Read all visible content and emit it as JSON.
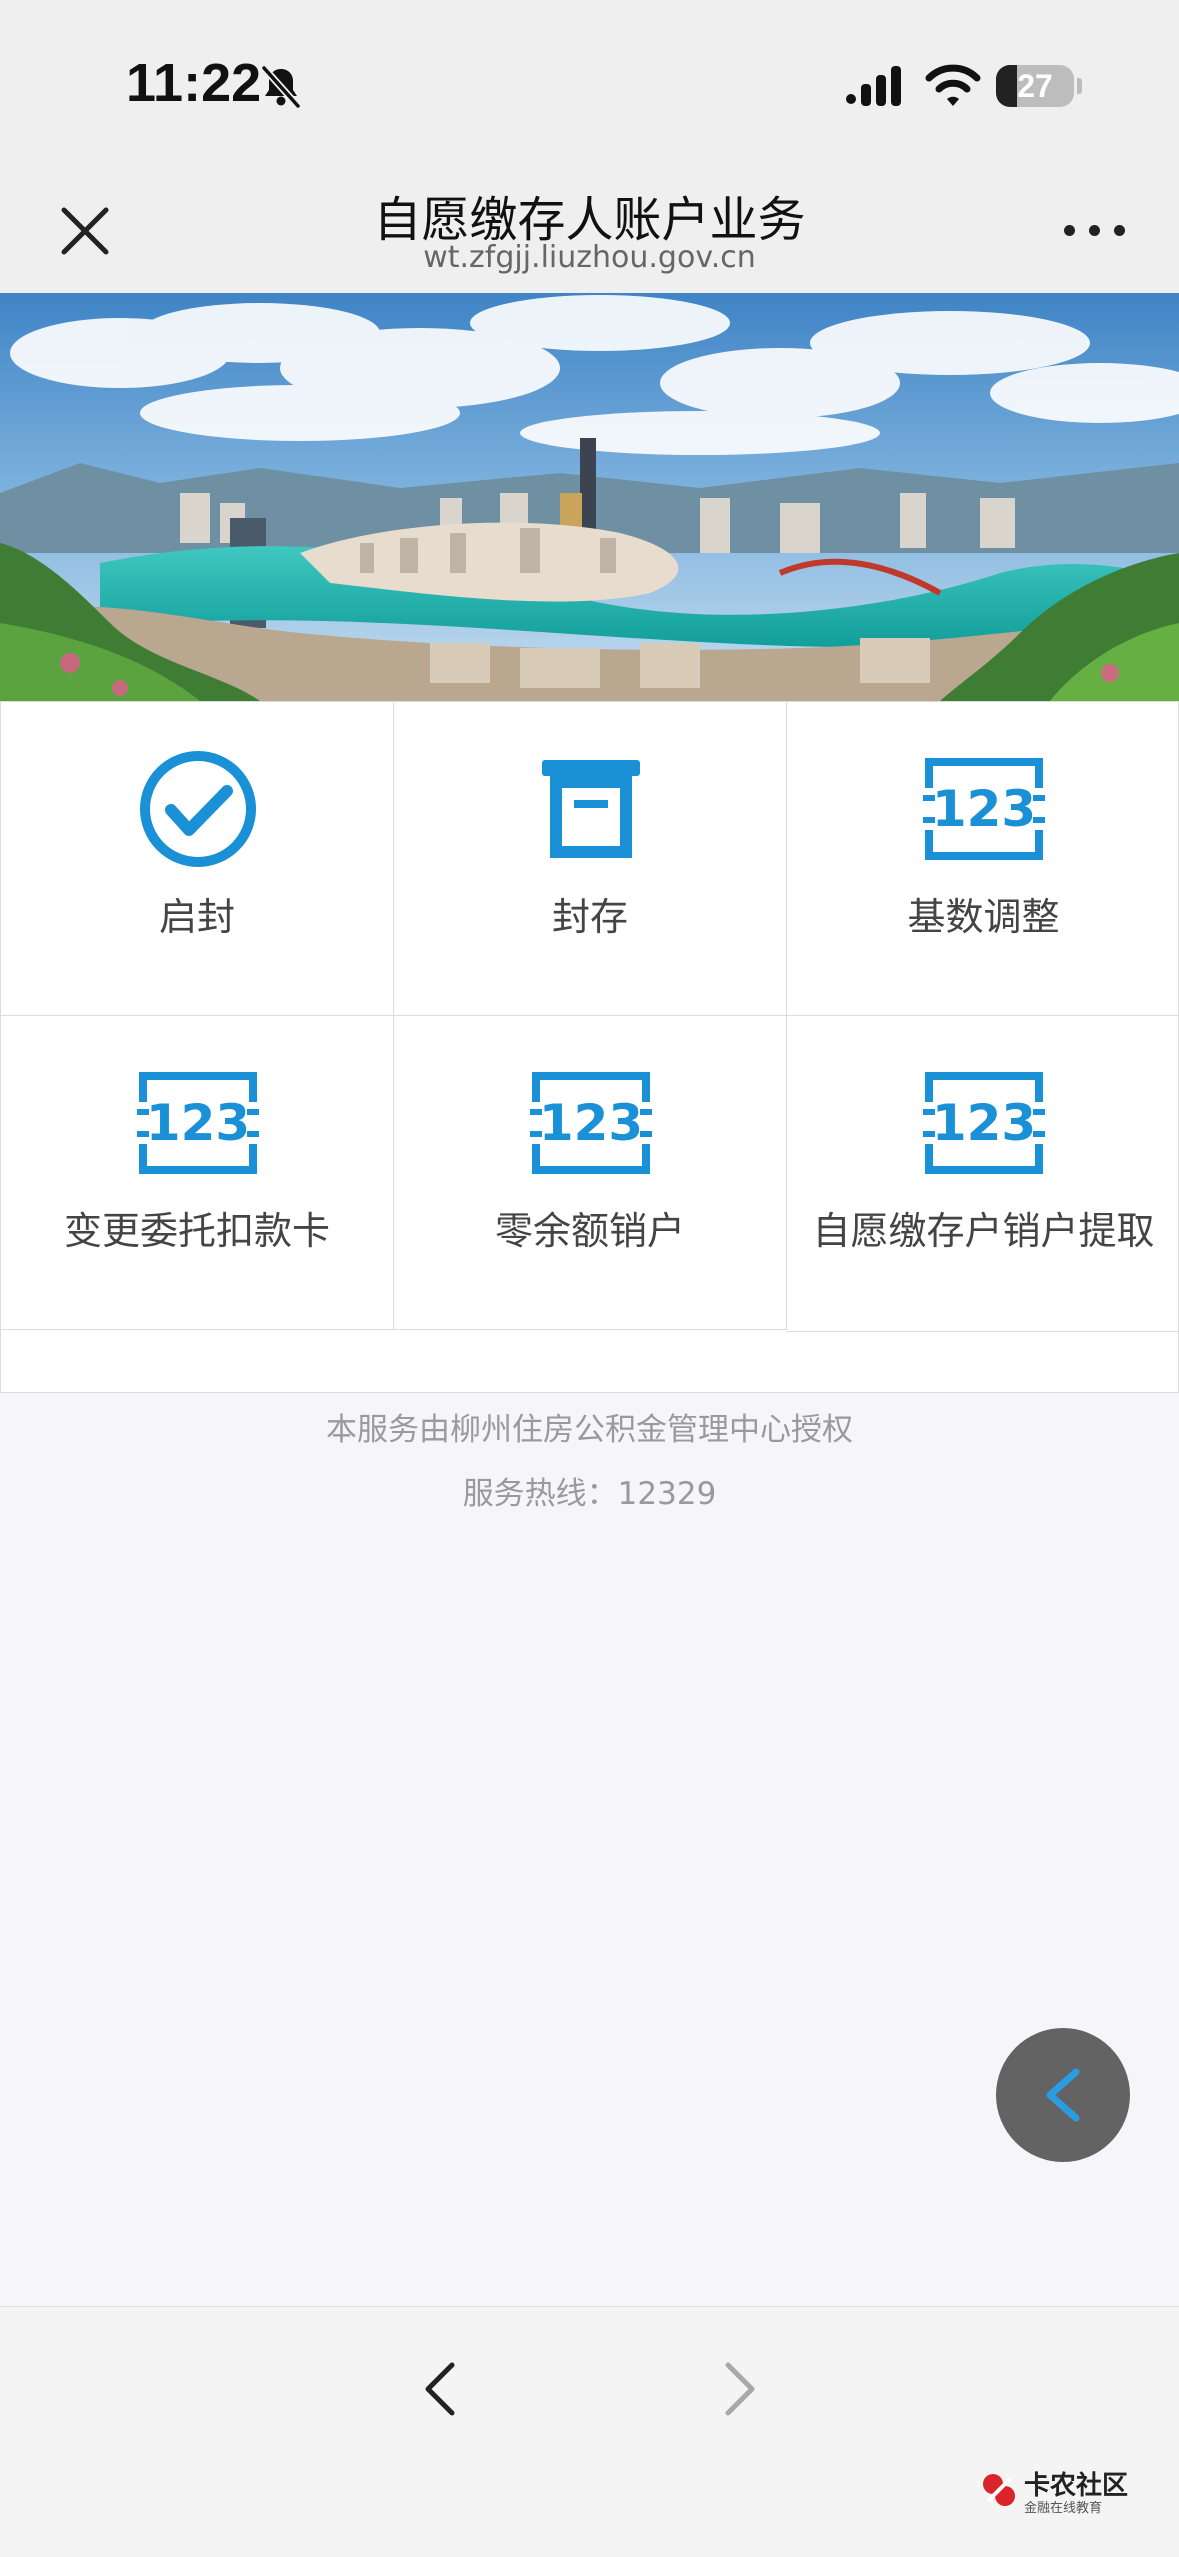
{
  "status_bar": {
    "time": "11:22",
    "battery_percent": "27"
  },
  "nav": {
    "title": "自愿缴存人账户业务",
    "url": "wt.zfgjj.liuzhou.gov.cn"
  },
  "services": [
    {
      "label": "启封",
      "icon": "check-circle-icon"
    },
    {
      "label": "封存",
      "icon": "archive-box-icon"
    },
    {
      "label": "基数调整",
      "icon": "number-123-icon"
    },
    {
      "label": "变更委托扣款卡",
      "icon": "number-123-icon"
    },
    {
      "label": "零余额销户",
      "icon": "number-123-icon"
    },
    {
      "label": "自愿缴存户销户提取",
      "icon": "number-123-icon"
    }
  ],
  "footer": {
    "authorization": "本服务由柳州住房公积金管理中心授权",
    "hotline": "服务热线：12329"
  },
  "watermark": {
    "name": "卡农社区",
    "tagline": "金融在线教育"
  },
  "colors": {
    "accent_blue": "#1a90d6",
    "float_button": "#636363"
  }
}
